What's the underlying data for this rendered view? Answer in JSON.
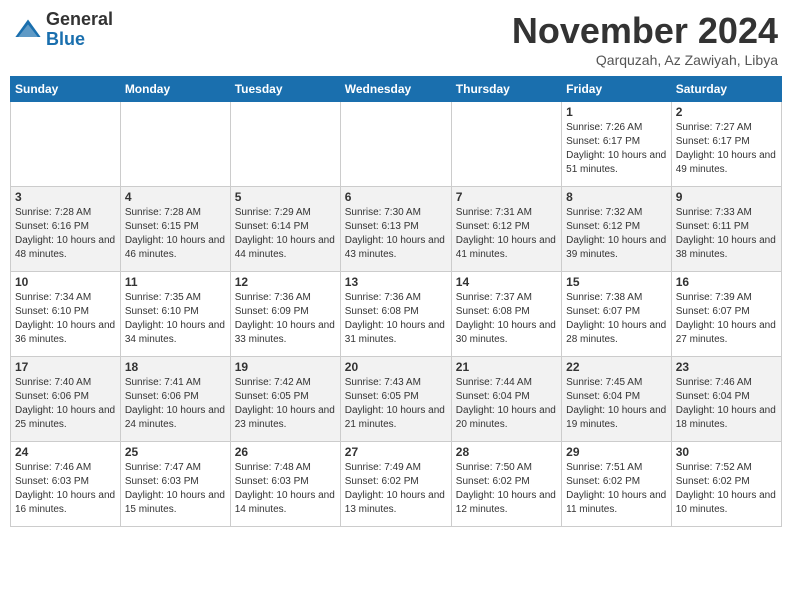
{
  "header": {
    "logo_general": "General",
    "logo_blue": "Blue",
    "month_title": "November 2024",
    "location": "Qarquzah, Az Zawiyah, Libya"
  },
  "weekdays": [
    "Sunday",
    "Monday",
    "Tuesday",
    "Wednesday",
    "Thursday",
    "Friday",
    "Saturday"
  ],
  "weeks": [
    [
      {
        "day": "",
        "info": ""
      },
      {
        "day": "",
        "info": ""
      },
      {
        "day": "",
        "info": ""
      },
      {
        "day": "",
        "info": ""
      },
      {
        "day": "",
        "info": ""
      },
      {
        "day": "1",
        "info": "Sunrise: 7:26 AM\nSunset: 6:17 PM\nDaylight: 10 hours and 51 minutes."
      },
      {
        "day": "2",
        "info": "Sunrise: 7:27 AM\nSunset: 6:17 PM\nDaylight: 10 hours and 49 minutes."
      }
    ],
    [
      {
        "day": "3",
        "info": "Sunrise: 7:28 AM\nSunset: 6:16 PM\nDaylight: 10 hours and 48 minutes."
      },
      {
        "day": "4",
        "info": "Sunrise: 7:28 AM\nSunset: 6:15 PM\nDaylight: 10 hours and 46 minutes."
      },
      {
        "day": "5",
        "info": "Sunrise: 7:29 AM\nSunset: 6:14 PM\nDaylight: 10 hours and 44 minutes."
      },
      {
        "day": "6",
        "info": "Sunrise: 7:30 AM\nSunset: 6:13 PM\nDaylight: 10 hours and 43 minutes."
      },
      {
        "day": "7",
        "info": "Sunrise: 7:31 AM\nSunset: 6:12 PM\nDaylight: 10 hours and 41 minutes."
      },
      {
        "day": "8",
        "info": "Sunrise: 7:32 AM\nSunset: 6:12 PM\nDaylight: 10 hours and 39 minutes."
      },
      {
        "day": "9",
        "info": "Sunrise: 7:33 AM\nSunset: 6:11 PM\nDaylight: 10 hours and 38 minutes."
      }
    ],
    [
      {
        "day": "10",
        "info": "Sunrise: 7:34 AM\nSunset: 6:10 PM\nDaylight: 10 hours and 36 minutes."
      },
      {
        "day": "11",
        "info": "Sunrise: 7:35 AM\nSunset: 6:10 PM\nDaylight: 10 hours and 34 minutes."
      },
      {
        "day": "12",
        "info": "Sunrise: 7:36 AM\nSunset: 6:09 PM\nDaylight: 10 hours and 33 minutes."
      },
      {
        "day": "13",
        "info": "Sunrise: 7:36 AM\nSunset: 6:08 PM\nDaylight: 10 hours and 31 minutes."
      },
      {
        "day": "14",
        "info": "Sunrise: 7:37 AM\nSunset: 6:08 PM\nDaylight: 10 hours and 30 minutes."
      },
      {
        "day": "15",
        "info": "Sunrise: 7:38 AM\nSunset: 6:07 PM\nDaylight: 10 hours and 28 minutes."
      },
      {
        "day": "16",
        "info": "Sunrise: 7:39 AM\nSunset: 6:07 PM\nDaylight: 10 hours and 27 minutes."
      }
    ],
    [
      {
        "day": "17",
        "info": "Sunrise: 7:40 AM\nSunset: 6:06 PM\nDaylight: 10 hours and 25 minutes."
      },
      {
        "day": "18",
        "info": "Sunrise: 7:41 AM\nSunset: 6:06 PM\nDaylight: 10 hours and 24 minutes."
      },
      {
        "day": "19",
        "info": "Sunrise: 7:42 AM\nSunset: 6:05 PM\nDaylight: 10 hours and 23 minutes."
      },
      {
        "day": "20",
        "info": "Sunrise: 7:43 AM\nSunset: 6:05 PM\nDaylight: 10 hours and 21 minutes."
      },
      {
        "day": "21",
        "info": "Sunrise: 7:44 AM\nSunset: 6:04 PM\nDaylight: 10 hours and 20 minutes."
      },
      {
        "day": "22",
        "info": "Sunrise: 7:45 AM\nSunset: 6:04 PM\nDaylight: 10 hours and 19 minutes."
      },
      {
        "day": "23",
        "info": "Sunrise: 7:46 AM\nSunset: 6:04 PM\nDaylight: 10 hours and 18 minutes."
      }
    ],
    [
      {
        "day": "24",
        "info": "Sunrise: 7:46 AM\nSunset: 6:03 PM\nDaylight: 10 hours and 16 minutes."
      },
      {
        "day": "25",
        "info": "Sunrise: 7:47 AM\nSunset: 6:03 PM\nDaylight: 10 hours and 15 minutes."
      },
      {
        "day": "26",
        "info": "Sunrise: 7:48 AM\nSunset: 6:03 PM\nDaylight: 10 hours and 14 minutes."
      },
      {
        "day": "27",
        "info": "Sunrise: 7:49 AM\nSunset: 6:02 PM\nDaylight: 10 hours and 13 minutes."
      },
      {
        "day": "28",
        "info": "Sunrise: 7:50 AM\nSunset: 6:02 PM\nDaylight: 10 hours and 12 minutes."
      },
      {
        "day": "29",
        "info": "Sunrise: 7:51 AM\nSunset: 6:02 PM\nDaylight: 10 hours and 11 minutes."
      },
      {
        "day": "30",
        "info": "Sunrise: 7:52 AM\nSunset: 6:02 PM\nDaylight: 10 hours and 10 minutes."
      }
    ]
  ]
}
